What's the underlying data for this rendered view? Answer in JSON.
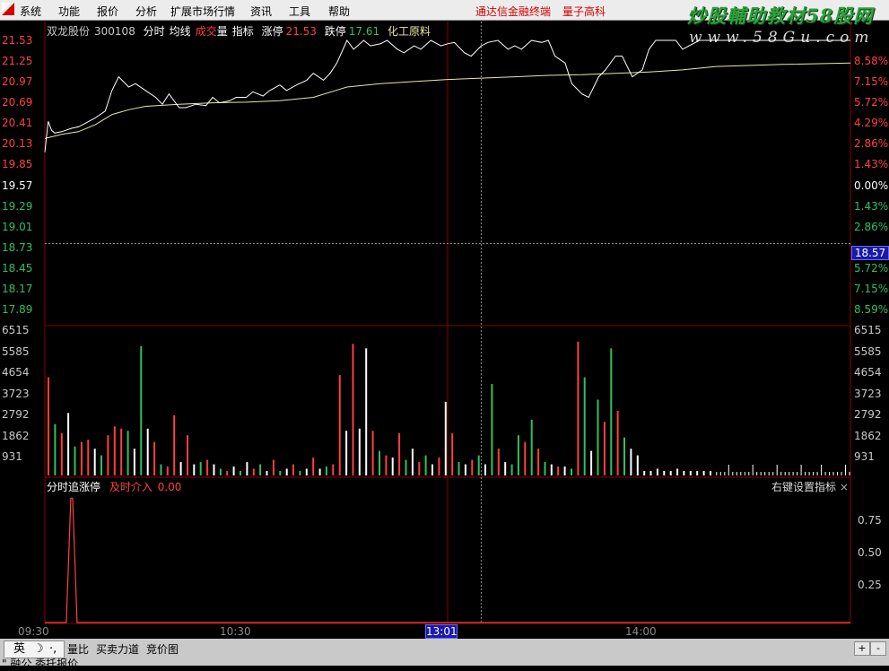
{
  "menu": [
    "系统",
    "功能",
    "报价",
    "分析",
    "扩展市场行情",
    "资讯",
    "工具",
    "帮助"
  ],
  "promo": [
    "通达信金融终端",
    "量子高科"
  ],
  "watermark": {
    "line1": "炒股輔助教材58股网",
    "line2": "www.58Gu.com"
  },
  "info": {
    "stock_name": "双龙股份",
    "stock_code": "300108",
    "t1": "分时",
    "t2": "均线",
    "t3": "成交",
    "t4": "量",
    "t5": "指标",
    "limit_up_label": "涨停",
    "limit_up_value": "21.53",
    "limit_down_label": "跌停",
    "limit_down_value": "17.61",
    "sector": "化工原料"
  },
  "price_axis": {
    "left": [
      "21.53",
      "21.25",
      "20.97",
      "20.69",
      "20.41",
      "20.13",
      "19.85",
      "19.57",
      "19.29",
      "19.01",
      "18.73",
      "18.45",
      "18.17",
      "17.89"
    ],
    "right": [
      "",
      "8.58%",
      "7.15%",
      "5.72%",
      "4.29%",
      "2.86%",
      "1.43%",
      "0.00%",
      "1.43%",
      "2.86%",
      "",
      "5.72%",
      "7.15%",
      "8.59%"
    ],
    "current_price": "18.57"
  },
  "volume_axis": [
    "6515",
    "5585",
    "4654",
    "3723",
    "2792",
    "1862",
    "931"
  ],
  "indicator": {
    "title": "分时追涨停",
    "param_label": "及时介入",
    "param_value": "0.00",
    "right_label": "右键设置指标",
    "close": "×",
    "axis": [
      "0.75",
      "0.50",
      "0.25"
    ]
  },
  "time_axis": {
    "labels": [
      "09:30",
      "10:30",
      "14:00"
    ],
    "current": "13:01"
  },
  "bottom_tabs": [
    "量比",
    "买卖力道",
    "竞价图"
  ],
  "ime": {
    "lang": "英",
    "moon": "☽",
    "punct": "·,"
  },
  "scroll": {
    "plus": "+",
    "minus": "-"
  },
  "bottom_row2": [
    "\" 融公",
    "委托报价"
  ],
  "colors": {
    "up": "#ff4040",
    "down": "#30c060",
    "neutral": "#ffffff",
    "price_line": "#ffffff",
    "avg_line": "#e8e8a8",
    "grid": "#7a0000",
    "indicator_line": "#ff4040"
  },
  "chart_data": {
    "type": "line",
    "series": [
      {
        "x_minute": [
          0,
          1,
          2,
          3,
          5,
          8,
          10,
          12,
          15,
          18,
          20,
          22,
          25,
          27,
          30,
          33,
          35,
          37,
          40,
          42,
          45,
          48,
          50,
          52,
          55,
          57,
          60,
          62,
          65,
          67,
          70,
          72,
          75,
          78,
          80,
          83,
          85,
          87,
          90,
          92,
          95,
          97,
          100,
          102,
          105,
          107,
          110,
          112,
          115,
          118,
          120,
          122,
          125,
          127,
          130,
          132,
          135,
          138,
          140,
          142,
          145,
          148,
          150,
          152,
          155,
          157,
          160,
          162,
          165,
          167,
          170,
          172,
          175,
          178,
          180,
          182,
          185,
          188,
          190,
          195,
          200,
          220,
          240
        ],
        "y": [
          19.9,
          20.35,
          20.22,
          20.18,
          20.2,
          20.25,
          20.27,
          20.32,
          20.4,
          20.5,
          20.8,
          21.0,
          20.85,
          20.9,
          20.8,
          20.7,
          20.6,
          20.75,
          20.55,
          20.55,
          20.6,
          20.58,
          20.7,
          20.62,
          20.65,
          20.7,
          20.7,
          20.78,
          20.72,
          20.8,
          20.88,
          20.8,
          20.88,
          20.95,
          21.05,
          20.95,
          21.05,
          21.2,
          21.53,
          21.4,
          21.53,
          21.45,
          21.48,
          21.53,
          21.4,
          21.35,
          21.45,
          21.4,
          21.53,
          21.45,
          21.48,
          21.5,
          21.35,
          21.3,
          21.45,
          21.5,
          21.53,
          21.4,
          21.45,
          21.4,
          21.53,
          21.5,
          21.53,
          21.3,
          21.2,
          20.9,
          20.75,
          20.7,
          21.0,
          21.1,
          21.3,
          21.3,
          21.0,
          21.1,
          21.4,
          21.53,
          21.53,
          21.53,
          21.4,
          21.53,
          21.53,
          21.53,
          21.53
        ]
      },
      {
        "x_minute": [
          0,
          5,
          10,
          15,
          20,
          25,
          30,
          40,
          50,
          60,
          70,
          80,
          90,
          100,
          110,
          120,
          130,
          140,
          150,
          160,
          170,
          180,
          190,
          200,
          220,
          240
        ],
        "y": [
          20.1,
          20.16,
          20.2,
          20.3,
          20.45,
          20.52,
          20.57,
          20.6,
          20.62,
          20.63,
          20.65,
          20.7,
          20.85,
          20.9,
          20.93,
          20.96,
          20.98,
          21.0,
          21.02,
          21.03,
          21.05,
          21.07,
          21.1,
          21.15,
          21.18,
          21.2
        ]
      }
    ],
    "ylim": [
      17.61,
      21.53
    ],
    "xlim": [
      0,
      240
    ],
    "volume": [
      4400,
      2300,
      1900,
      2800,
      1300,
      1500,
      1600,
      1200,
      900,
      1800,
      2200,
      2100,
      2000,
      1200,
      5800,
      2100,
      1500,
      500,
      400,
      2700,
      600,
      1800,
      500,
      600,
      700,
      500,
      300,
      200,
      400,
      200,
      600,
      300,
      500,
      200,
      700,
      200,
      300,
      500,
      200,
      300,
      800,
      300,
      400,
      500,
      4500,
      2000,
      5900,
      2100,
      5700,
      2000,
      1100,
      900,
      800,
      1900,
      700,
      1200,
      600,
      900,
      500,
      800,
      3300,
      1900,
      600,
      500,
      700,
      900,
      500,
      4100,
      1200,
      600,
      500,
      1800,
      1500,
      2500,
      1200,
      600,
      500,
      400,
      400,
      300,
      6000,
      4400,
      1100,
      3400,
      2400,
      5700,
      2900,
      1700,
      1200,
      900,
      200,
      200,
      300,
      200,
      200,
      300,
      200,
      200,
      200,
      200,
      200
    ],
    "volume_colors": [
      "up",
      "down",
      "up",
      "neutral",
      "down",
      "up",
      "up",
      "neutral",
      "down",
      "up",
      "up",
      "up",
      "down",
      "neutral",
      "down",
      "neutral",
      "up",
      "down",
      "up",
      "up",
      "neutral",
      "up",
      "neutral",
      "down",
      "up",
      "neutral",
      "down",
      "up",
      "neutral",
      "down",
      "neutral",
      "up",
      "down",
      "neutral",
      "up",
      "down",
      "neutral",
      "up",
      "down",
      "neutral",
      "up",
      "neutral",
      "down",
      "up",
      "up",
      "neutral",
      "up",
      "neutral",
      "neutral",
      "up",
      "down",
      "up",
      "neutral",
      "up",
      "down",
      "neutral",
      "up",
      "down",
      "neutral",
      "up",
      "neutral",
      "up",
      "down",
      "neutral",
      "up",
      "down",
      "neutral",
      "down",
      "up",
      "neutral",
      "down",
      "down",
      "up",
      "down",
      "up",
      "down",
      "neutral",
      "up",
      "neutral",
      "down",
      "up",
      "down",
      "neutral",
      "down",
      "up",
      "down",
      "up",
      "down",
      "neutral",
      "neutral",
      "neutral",
      "neutral",
      "neutral",
      "neutral",
      "neutral",
      "neutral",
      "neutral",
      "neutral",
      "neutral",
      "neutral",
      "neutral"
    ],
    "indicator_spike": {
      "x_minute": 8,
      "value": 0.95
    }
  }
}
